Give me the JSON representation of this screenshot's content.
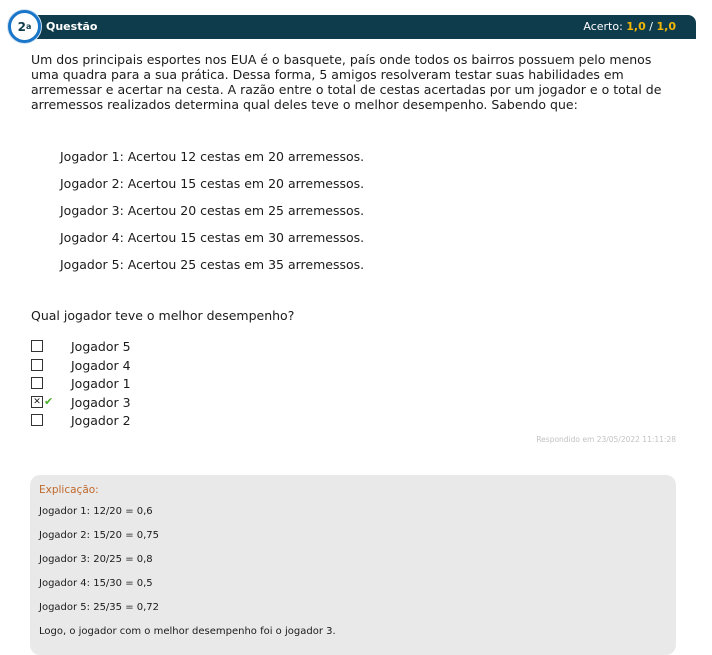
{
  "header": {
    "number": "2",
    "ordinal": "a",
    "title": "Questão",
    "score_label": "Acerto:",
    "score_value": "1,0",
    "score_sep": "/",
    "score_total": "1,0"
  },
  "question": {
    "text": "Um dos principais esportes nos EUA é o basquete, país onde todos os bairros possuem pelo menos uma quadra para a sua prática. Dessa forma, 5 amigos resolveram testar suas habilidades em arremessar e acertar na cesta. A razão entre o total de cestas acertadas por um jogador e o total de arremessos realizados determina qual deles teve o melhor desempenho. Sabendo que:",
    "players": [
      "Jogador 1: Acertou 12 cestas em 20 arremessos.",
      "Jogador 2: Acertou 15 cestas em 20 arremessos.",
      "Jogador 3: Acertou 20 cestas em 25 arremessos.",
      "Jogador 4: Acertou 15 cestas em 30 arremessos.",
      "Jogador 5: Acertou 25 cestas em 35 arremessos."
    ],
    "prompt": "Qual jogador teve o melhor desempenho?"
  },
  "options": [
    {
      "label": "Jogador 5",
      "checked": false
    },
    {
      "label": "Jogador 4",
      "checked": false
    },
    {
      "label": "Jogador 1",
      "checked": false
    },
    {
      "label": "Jogador 3",
      "checked": true,
      "correct": true
    },
    {
      "label": "Jogador 2",
      "checked": false
    }
  ],
  "answered": "Respondido em 23/05/2022 11:11:28",
  "explanation": {
    "title": "Explicação:",
    "lines": [
      "Jogador 1: 12/20 = 0,6",
      "Jogador 2: 15/20 = 0,75",
      "Jogador 3: 20/25 = 0,8",
      "Jogador 4: 15/30 = 0,5",
      "Jogador 5: 25/35 = 0,72",
      "Logo, o jogador com o melhor desempenho foi o jogador 3."
    ]
  },
  "colors": {
    "header_bg": "#0f3c4c",
    "score_accent": "#f2b705",
    "explanation_title": "#c0692c",
    "check_green": "#4caf2a"
  }
}
